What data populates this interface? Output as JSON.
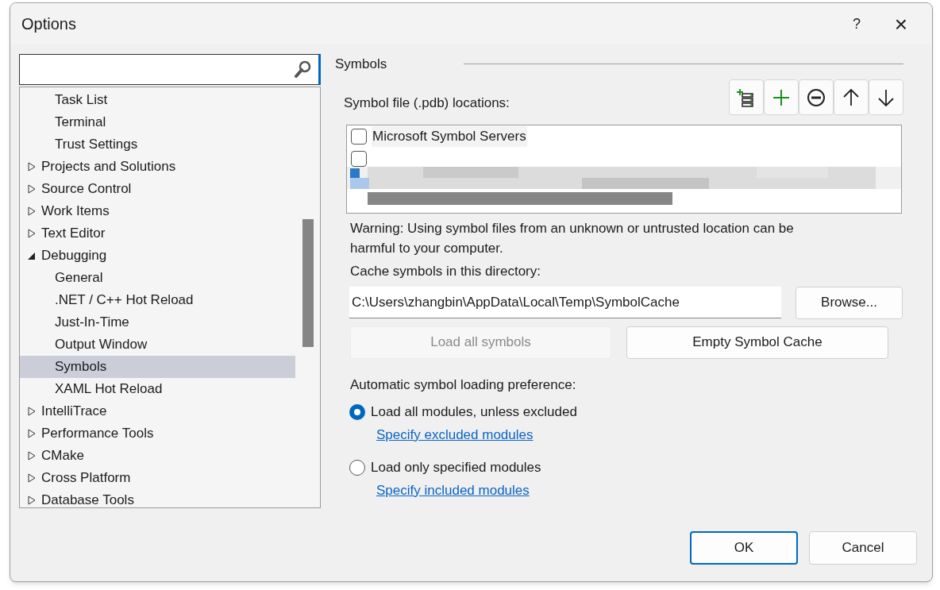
{
  "window": {
    "title": "Options",
    "help": "?",
    "close": "×"
  },
  "search": {
    "kind": "search"
  },
  "tree": {
    "items": [
      {
        "children": [
          {
            "label": "Task List",
            "selected": false
          },
          {
            "label": "Terminal",
            "selected": false
          },
          {
            "label": "Trust Settings",
            "selected": false
          }
        ]
      },
      {
        "label": "Projects and Solutions",
        "expanded": false,
        "selected": false
      },
      {
        "label": "Source Control",
        "expanded": false,
        "selected": false
      },
      {
        "label": "Work Items",
        "expanded": false,
        "selected": false
      },
      {
        "label": "Text Editor",
        "expanded": false,
        "selected": false
      },
      {
        "label": "Debugging",
        "expanded": true,
        "selected": false,
        "children": [
          {
            "label": "General",
            "selected": false
          },
          {
            "label": ".NET / C++ Hot Reload",
            "selected": false
          },
          {
            "label": "Just-In-Time",
            "selected": false
          },
          {
            "label": "Output Window",
            "selected": false
          },
          {
            "label": "Symbols",
            "selected": true
          },
          {
            "label": "XAML Hot Reload",
            "selected": false
          }
        ]
      },
      {
        "label": "IntelliTrace",
        "expanded": false,
        "selected": false
      },
      {
        "label": "Performance Tools",
        "expanded": false,
        "selected": false
      },
      {
        "label": "CMake",
        "expanded": false,
        "selected": false
      },
      {
        "label": "Cross Platform",
        "expanded": false,
        "selected": false
      },
      {
        "label": "Database Tools",
        "expanded": false,
        "selected": false
      }
    ]
  },
  "panel": {
    "title": "Symbols",
    "locations_label": "Symbol file (.pdb) locations:",
    "toolbar": [
      {
        "kind": "server"
      },
      {
        "kind": "add"
      },
      {
        "kind": "remove"
      },
      {
        "kind": "up"
      },
      {
        "kind": "down"
      }
    ],
    "locations": [
      {
        "kind": "text",
        "label": "Microsoft Symbol Servers",
        "checked": false
      },
      {
        "kind": "obscured",
        "checked": false
      },
      {
        "kind": "picture"
      }
    ],
    "warning": "Warning: Using symbol files from an unknown or untrusted location can be harmful to your computer.",
    "cache_label": "Cache symbols in this directory:",
    "cache_path": "C:\\Users\\zhangbin\\AppData\\Local\\Temp\\SymbolCache",
    "browse": "Browse...",
    "load_all": {
      "label": "Load all symbols",
      "disabled": true
    },
    "empty_cache": {
      "label": "Empty Symbol Cache",
      "disabled": false
    },
    "preference_label": "Automatic symbol loading preference:",
    "options": [
      {
        "label": "Load all modules, unless excluded",
        "selected": true,
        "link": "Specify excluded modules"
      },
      {
        "label": "Load only specified modules",
        "selected": false,
        "link": "Specify included modules"
      }
    ]
  },
  "buttons": [
    {
      "label": "OK",
      "default": true
    },
    {
      "label": "Cancel",
      "default": false
    }
  ]
}
